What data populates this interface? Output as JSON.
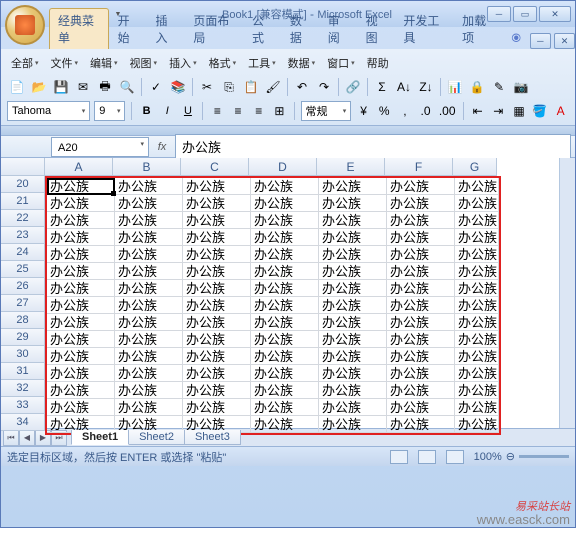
{
  "title": {
    "doc": "Book1",
    "mode": "[兼容模式]",
    "app": "Microsoft Excel"
  },
  "tabs": [
    "经典菜单",
    "开始",
    "插入",
    "页面布局",
    "公式",
    "数据",
    "审阅",
    "视图",
    "开发工具",
    "加载项"
  ],
  "menus": {
    "all": "全部",
    "file": "文件",
    "edit": "编辑",
    "view": "视图",
    "insert": "插入",
    "format": "格式",
    "tools": "工具",
    "data": "数据",
    "window": "窗口",
    "help": "帮助"
  },
  "font": {
    "name": "Tahoma",
    "size": "9",
    "style": "常规"
  },
  "namebox": "A20",
  "formula": "办公族",
  "columns": [
    "A",
    "B",
    "C",
    "D",
    "E",
    "F",
    "G"
  ],
  "rows": [
    20,
    21,
    22,
    23,
    24,
    25,
    26,
    27,
    28,
    29,
    30,
    31,
    32,
    33,
    34
  ],
  "cell_value": "办公族",
  "sheets": [
    "Sheet1",
    "Sheet2",
    "Sheet3"
  ],
  "status": "选定目标区域，然后按 ENTER 或选择 \"粘贴\"",
  "zoom": "100%",
  "watermark": {
    "text": "易采站长站",
    "url": "www.easck.com"
  }
}
